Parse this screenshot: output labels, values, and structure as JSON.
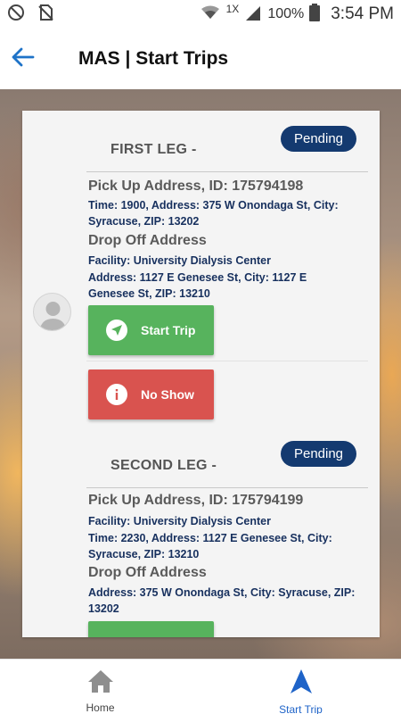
{
  "status_bar": {
    "network_badge": "1X",
    "battery_percent": "100%",
    "time": "3:54 PM"
  },
  "app_bar": {
    "title": "MAS | Start Trips"
  },
  "first_leg": {
    "title": "FIRST LEG -",
    "status": "Pending",
    "pickup_heading": "Pick Up Address, ID: 175794198",
    "pickup_details": "Time: 1900, Address: 375 W Onondaga St, City: Syracuse, ZIP: 13202",
    "dropoff_heading": "Drop Off Address",
    "dropoff_facility": "Facility:  University Dialysis Center",
    "dropoff_details": "Address: 1127 E Genesee St, City: 1127 E Genesee St, ZIP: 13210",
    "start_button": "Start Trip",
    "noshow_button": "No Show"
  },
  "second_leg": {
    "title": "SECOND LEG -",
    "status": "Pending",
    "pickup_heading": "Pick Up Address, ID: 175794199",
    "pickup_facility": "Facility:  University Dialysis Center",
    "pickup_details": "Time: 2230, Address: 1127 E Genesee St, City: Syracuse, ZIP: 13210",
    "dropoff_heading": "Drop Off Address",
    "dropoff_details": "Address: 375 W Onondaga St, City: Syracuse, ZIP: 13202"
  },
  "bottom_nav": {
    "home_label": "Home",
    "start_trip_label": "Start Trip"
  },
  "colors": {
    "accent_blue": "#1e63c8",
    "badge_navy": "#143a70",
    "text_navy": "#17305e",
    "start_green": "#57b35d",
    "noshow_red": "#d9534f"
  },
  "icons": {
    "status_left": [
      "do-not-disturb-icon",
      "no-sim-icon"
    ],
    "status_right": [
      "wifi-icon",
      "signal-icon",
      "battery-icon"
    ],
    "back": "arrow-back-icon",
    "start_trip": "navigation-arrow-icon",
    "no_show": "info-icon",
    "home": "home-icon",
    "start_nav": "navigation-icon"
  }
}
